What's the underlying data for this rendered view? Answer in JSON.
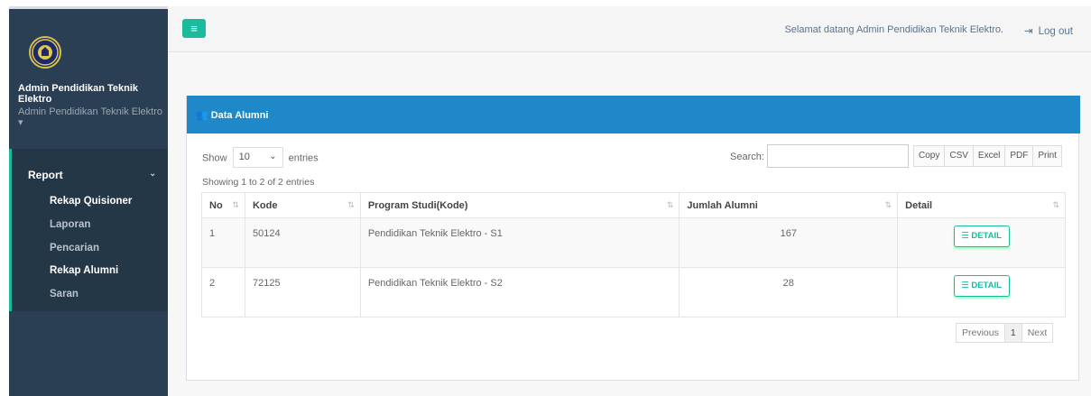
{
  "app": {
    "profile_name": "Admin Pendidikan Teknik Elektro",
    "profile_sub": "Admin Pendidikan Teknik Elektro ▾"
  },
  "sidebar": {
    "section_label": "Report",
    "items": [
      {
        "label": "Rekap Quisioner",
        "active": true
      },
      {
        "label": "Laporan",
        "active": false
      },
      {
        "label": "Pencarian",
        "active": false
      },
      {
        "label": "Rekap Alumni",
        "active": true
      },
      {
        "label": "Saran",
        "active": false
      }
    ]
  },
  "topbar": {
    "menu_icon": "bars-icon",
    "welcome_text": "Selamat datang Admin Pendidikan Teknik Elektro.",
    "logout_label": "Log out",
    "logout_icon": "sign-out-icon"
  },
  "panel": {
    "title": "Data Alumni",
    "title_icon": "users-icon"
  },
  "table_controls": {
    "show_label": "Show",
    "entries_value": "10",
    "entries_label": "entries",
    "search_label": "Search:",
    "search_value": "",
    "export_buttons": [
      "Copy",
      "CSV",
      "Excel",
      "PDF",
      "Print"
    ],
    "info_text": "Showing 1 to 2 of 2 entries"
  },
  "table": {
    "columns": [
      "No",
      "Kode",
      "Program Studi(Kode)",
      "Jumlah Alumni",
      "Detail"
    ],
    "rows": [
      {
        "no": "1",
        "kode": "50124",
        "prodi": "Pendidikan Teknik Elektro - S1",
        "jumlah": "167",
        "detail_label": "DETAIL"
      },
      {
        "no": "2",
        "kode": "72125",
        "prodi": "Pendidikan Teknik Elektro - S2",
        "jumlah": "28",
        "detail_label": "DETAIL"
      }
    ]
  },
  "pagination": {
    "previous": "Previous",
    "current": "1",
    "next": "Next"
  },
  "colors": {
    "sidebar_bg": "#2a3f54",
    "accent_green": "#1abb9c",
    "panel_header_blue": "#1e88c9"
  }
}
